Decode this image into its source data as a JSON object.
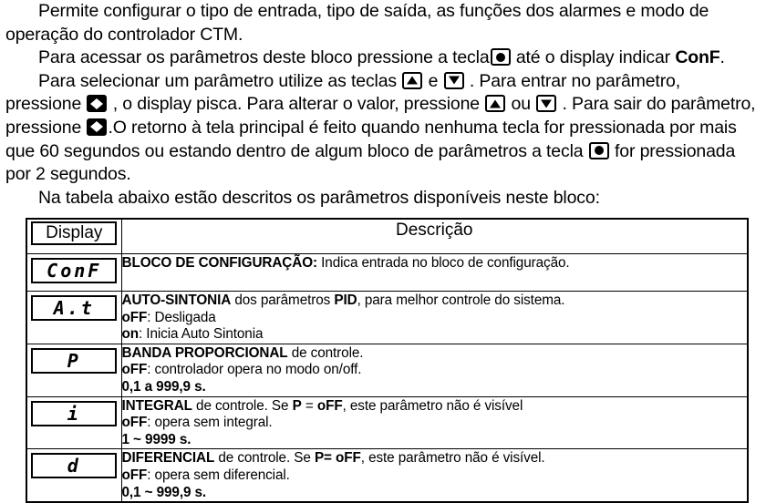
{
  "document": {
    "paragraphs": [
      {
        "id": "p1",
        "segments": [
          {
            "type": "text",
            "value": "Permite configurar o tipo de entrada, tipo de saída,  as funções dos alarmes e modo de operação do controlador CTM."
          }
        ]
      },
      {
        "id": "p2",
        "segments": [
          {
            "type": "text",
            "value": "Para acessar os parâmetros deste bloco  pressione a tecla "
          },
          {
            "type": "key",
            "value": "dot-key"
          },
          {
            "type": "text",
            "value": " até o display indicar "
          },
          {
            "type": "bold",
            "value": "ConF"
          },
          {
            "type": "text",
            "value": "."
          }
        ]
      },
      {
        "id": "p3",
        "segments": [
          {
            "type": "text",
            "value": "Para selecionar um parâmetro utilize as teclas "
          },
          {
            "type": "key",
            "value": "up-arrow-key"
          },
          {
            "type": "text",
            "value": " e "
          },
          {
            "type": "key",
            "value": "down-arrow-key"
          },
          {
            "type": "text",
            "value": " . Para entrar no parâmetro, pressione "
          },
          {
            "type": "key",
            "value": "left-right-arrow-key"
          },
          {
            "type": "text",
            "value": " , o display pisca. Para alterar o valor, pressione "
          },
          {
            "type": "key",
            "value": "up-arrow-key"
          },
          {
            "type": "text",
            "value": " ou "
          },
          {
            "type": "key",
            "value": "down-arrow-key"
          },
          {
            "type": "text",
            "value": " . Para sair do parâmetro, pressione "
          },
          {
            "type": "key",
            "value": "left-right-arrow-key"
          },
          {
            "type": "text",
            "value": ".O retorno à tela principal é feito quando nenhuma tecla for pressionada por mais que 60 segundos ou estando dentro de algum bloco de parâmetros a tecla "
          },
          {
            "type": "key",
            "value": "dot-key"
          },
          {
            "type": "text",
            "value": "  for pressionada por 2 segundos."
          }
        ]
      },
      {
        "id": "p4",
        "segments": [
          {
            "type": "text",
            "value": "Na tabela abaixo estão descritos os parâmetros disponíveis neste bloco:"
          }
        ]
      }
    ],
    "text_lines": {
      "p1_l1": "Permite configurar o tipo de entrada, tipo de saída,  as funções dos alarmes e modo",
      "p1_l2": "de operação do controlador CTM.",
      "p2_a": "Para acessar os parâmetros deste bloco  pressione a tecla",
      "p2_b": "até o display indicar",
      "p2_c": "ConF",
      "p2_d": ".",
      "p3_a": "Para selecionar um parâmetro utilize as teclas",
      "p3_b": "e",
      "p3_c": ". Para entrar no parâmetro,",
      "p3_d": "pressione",
      "p3_e": ", o display pisca. Para alterar o valor, pressione",
      "p3_f": "ou",
      "p3_g": ". Para sair do",
      "p3_h": "parâmetro, pressione",
      "p3_i": ".O retorno à tela principal é feito quando nenhuma tecla for",
      "p3_j": "pressionada por mais que 60 segundos ou estando dentro de algum bloco de",
      "p3_k": "parâmetros a tecla",
      "p3_l": "for pressionada por 2 segundos.",
      "p4_l1": "Na tabela abaixo estão descritos os parâmetros disponíveis neste bloco:"
    }
  },
  "table": {
    "headers": {
      "display": "Display",
      "description": "Descrição"
    },
    "rows": [
      {
        "display": "ConF",
        "lines": [
          {
            "bold": "BLOCO DE CONFIGURAÇÃO:",
            "rest": " Indica entrada no bloco de configuração."
          }
        ]
      },
      {
        "display": "A.t",
        "lines": [
          {
            "bold": "AUTO-SINTONIA",
            "rest": " dos parâmetros ",
            "bold2": "PID",
            "rest2": ", para melhor controle do sistema."
          },
          {
            "bold": "oFF",
            "rest": ": Desligada"
          },
          {
            "bold": "on",
            "rest": ": Inicia Auto Sintonia"
          }
        ]
      },
      {
        "display": "P",
        "lines": [
          {
            "bold": "BANDA PROPORCIONAL",
            "rest": " de controle."
          },
          {
            "bold": "oFF",
            "rest": ": controlador opera no modo on/off."
          },
          {
            "bold": "0,1 a 999,9 s.",
            "rest": ""
          }
        ]
      },
      {
        "display": "i",
        "lines": [
          {
            "bold": "INTEGRAL",
            "rest": " de controle. Se ",
            "bold2": "P",
            "rest2": " = ",
            "bold3": "oFF",
            "rest3": ", este parâmetro não é visível"
          },
          {
            "bold": "oFF",
            "rest": ": opera sem integral."
          },
          {
            "bold": "1 ~ 9999 s.",
            "rest": ""
          }
        ]
      },
      {
        "display": "d",
        "lines": [
          {
            "bold": "DIFERENCIAL",
            "rest": " de controle. Se ",
            "bold2": "P=",
            "rest2": " ",
            "bold3": "oFF",
            "rest3": ", este parâmetro não é visível."
          },
          {
            "bold": "oFF",
            "rest": ": opera sem diferencial."
          },
          {
            "bold": "0,1 ~ 999,9 s.",
            "rest": ""
          }
        ]
      }
    ]
  },
  "colors": {
    "text": "#000000",
    "background": "#ffffff",
    "border": "#000000"
  }
}
